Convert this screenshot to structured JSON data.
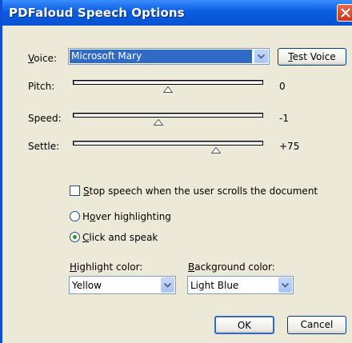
{
  "window": {
    "title": "PDFaloud Speech Options"
  },
  "voice": {
    "label": "Voice:",
    "value": "Microsoft Mary",
    "test_button": "Test Voice"
  },
  "sliders": [
    {
      "label": "Pitch:",
      "value_text": "0",
      "position": 0.5
    },
    {
      "label": "Speed:",
      "value_text": "-1",
      "position": 0.45
    },
    {
      "label": "Settle:",
      "value_text": "+75",
      "position": 0.75
    }
  ],
  "stop_speech": {
    "label": "Stop speech when the user scrolls the document",
    "checked": false
  },
  "mode": {
    "hover_label": "Hover highlighting",
    "click_label": "Click and speak",
    "selected": "click"
  },
  "highlight_color": {
    "label": "Highlight color:",
    "value": "Yellow"
  },
  "background_color": {
    "label": "Background color:",
    "value": "Light Blue"
  },
  "buttons": {
    "ok": "OK",
    "cancel": "Cancel"
  },
  "colors": {
    "titlebar": "#0a5ddf",
    "dialog_bg": "#ece9d8",
    "selection": "#316ac5"
  }
}
